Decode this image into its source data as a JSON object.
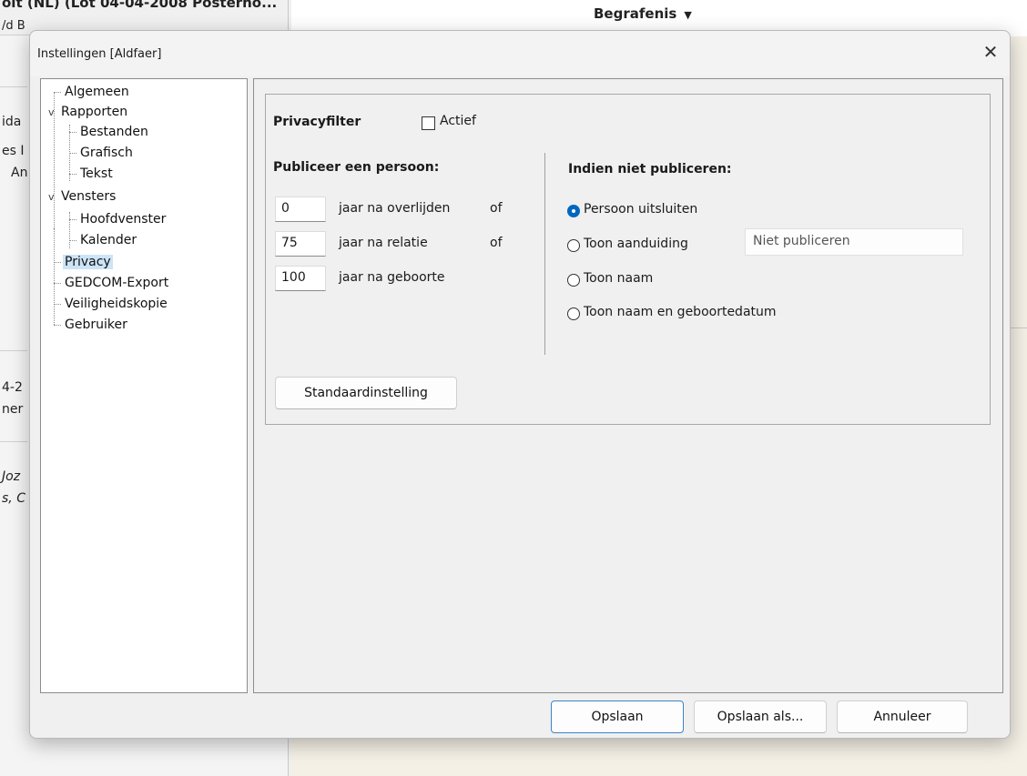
{
  "background": {
    "left_title": "oit (NL) (Lot 04-04-2008 Posterno...",
    "left_sub": "/d B",
    "right_title": "Begrafenis",
    "right_title_arrow": "▼",
    "left_peek": [
      "ida",
      "es I",
      "An",
      "4-2",
      "ner",
      "Joz",
      "s, C"
    ]
  },
  "dialog": {
    "title": "Instellingen [Aldfaer]",
    "close_glyph": "✕",
    "tree": {
      "items": [
        "Algemeen",
        "Rapporten",
        "Bestanden",
        "Grafisch",
        "Tekst",
        "Vensters",
        "Hoofdvenster",
        "Kalender",
        "Privacy",
        "GEDCOM-Export",
        "Veiligheidskopie",
        "Gebruiker"
      ],
      "expander_glyph": "v",
      "selected": "Privacy"
    },
    "privacy": {
      "filter_label": "Privacyfilter",
      "actief_label": "Actief",
      "actief_checked": false,
      "publish_heading": "Publiceer een persoon:",
      "rows": [
        {
          "value": "0",
          "label": "jaar na overlijden",
          "suffix": "of"
        },
        {
          "value": "75",
          "label": "jaar na relatie",
          "suffix": "of"
        },
        {
          "value": "100",
          "label": "jaar na geboorte",
          "suffix": ""
        }
      ],
      "not_publish_heading": "Indien niet publiceren:",
      "options": [
        "Persoon uitsluiten",
        "Toon aanduiding",
        "Toon naam",
        "Toon naam en geboortedatum"
      ],
      "selected_option": "Persoon uitsluiten",
      "aanduiding_placeholder": "Niet publiceren",
      "default_button": "Standaardinstelling"
    },
    "footer": {
      "save": "Opslaan",
      "save_as": "Opslaan als...",
      "cancel": "Annuleer"
    },
    "colors": {
      "accent": "#0067c0",
      "selection": "#cce4f7"
    }
  }
}
